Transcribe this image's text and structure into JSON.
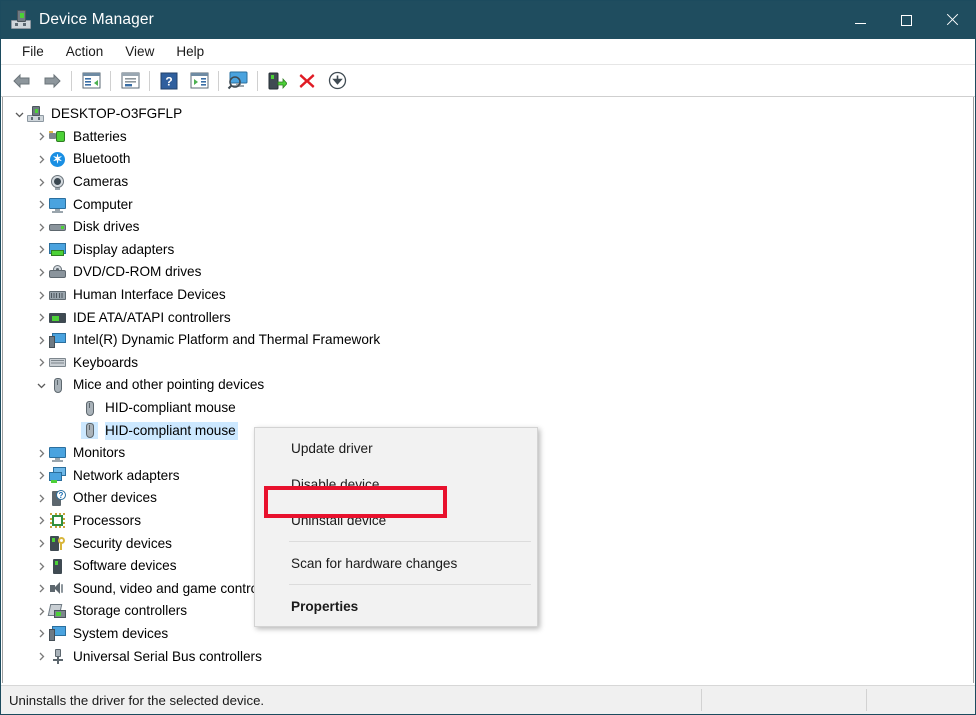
{
  "window": {
    "title": "Device Manager",
    "app_icon": "device-manager-icon",
    "titlebar_color": "#1f4d5f",
    "controls": {
      "minimize": "minimize-icon",
      "maximize": "maximize-icon",
      "close": "close-icon"
    }
  },
  "menubar": {
    "items": [
      {
        "label": "File"
      },
      {
        "label": "Action"
      },
      {
        "label": "View"
      },
      {
        "label": "Help"
      }
    ]
  },
  "toolbar": {
    "buttons": [
      {
        "name": "back-icon"
      },
      {
        "name": "forward-icon"
      },
      {
        "name": "separator"
      },
      {
        "name": "show-hide-console-tree-icon"
      },
      {
        "name": "separator"
      },
      {
        "name": "properties-icon"
      },
      {
        "name": "separator"
      },
      {
        "name": "help-icon"
      },
      {
        "name": "show-hide-action-pane-icon"
      },
      {
        "name": "separator"
      },
      {
        "name": "scan-for-hardware-changes-icon"
      },
      {
        "name": "separator"
      },
      {
        "name": "update-driver-icon"
      },
      {
        "name": "uninstall-device-icon"
      },
      {
        "name": "disable-device-icon"
      }
    ]
  },
  "tree": {
    "root": {
      "label": "DESKTOP-O3FGFLP",
      "icon": "computer-icon",
      "expanded": true
    },
    "items": [
      {
        "label": "Batteries",
        "icon": "battery-icon",
        "expanded": false,
        "level": 1
      },
      {
        "label": "Bluetooth",
        "icon": "bluetooth-icon",
        "expanded": false,
        "level": 1
      },
      {
        "label": "Cameras",
        "icon": "camera-icon",
        "expanded": false,
        "level": 1
      },
      {
        "label": "Computer",
        "icon": "monitor-icon",
        "expanded": false,
        "level": 1
      },
      {
        "label": "Disk drives",
        "icon": "disk-drive-icon",
        "expanded": false,
        "level": 1
      },
      {
        "label": "Display adapters",
        "icon": "display-adapter-icon",
        "expanded": false,
        "level": 1
      },
      {
        "label": "DVD/CD-ROM drives",
        "icon": "dvd-drive-icon",
        "expanded": false,
        "level": 1
      },
      {
        "label": "Human Interface Devices",
        "icon": "hid-icon",
        "expanded": false,
        "level": 1
      },
      {
        "label": "IDE ATA/ATAPI controllers",
        "icon": "ide-controller-icon",
        "expanded": false,
        "level": 1
      },
      {
        "label": "Intel(R) Dynamic Platform and Thermal Framework",
        "icon": "system-device-icon",
        "expanded": false,
        "level": 1
      },
      {
        "label": "Keyboards",
        "icon": "keyboard-icon",
        "expanded": false,
        "level": 1
      },
      {
        "label": "Mice and other pointing devices",
        "icon": "mouse-icon",
        "expanded": true,
        "level": 1
      },
      {
        "label": "HID-compliant mouse",
        "icon": "mouse-icon",
        "expanded": null,
        "level": 2,
        "selected": false
      },
      {
        "label": "HID-compliant mouse",
        "icon": "mouse-icon",
        "expanded": null,
        "level": 2,
        "selected": true
      },
      {
        "label": "Monitors",
        "icon": "monitor-icon",
        "expanded": false,
        "level": 1
      },
      {
        "label": "Network adapters",
        "icon": "network-adapter-icon",
        "expanded": false,
        "level": 1
      },
      {
        "label": "Other devices",
        "icon": "unknown-device-icon",
        "expanded": false,
        "level": 1
      },
      {
        "label": "Processors",
        "icon": "processor-icon",
        "expanded": false,
        "level": 1
      },
      {
        "label": "Security devices",
        "icon": "security-device-icon",
        "expanded": false,
        "level": 1
      },
      {
        "label": "Software devices",
        "icon": "software-device-icon",
        "expanded": false,
        "level": 1
      },
      {
        "label": "Sound, video and game controllers",
        "icon": "sound-icon",
        "expanded": false,
        "level": 1
      },
      {
        "label": "Storage controllers",
        "icon": "storage-controller-icon",
        "expanded": false,
        "level": 1
      },
      {
        "label": "System devices",
        "icon": "system-device-icon",
        "expanded": false,
        "level": 1
      },
      {
        "label": "Universal Serial Bus controllers",
        "icon": "usb-controller-icon",
        "expanded": false,
        "level": 1
      }
    ]
  },
  "context_menu": {
    "items": [
      {
        "label": "Update driver",
        "bold": false,
        "highlighted": false
      },
      {
        "label": "Disable device",
        "bold": false,
        "highlighted": false
      },
      {
        "label": "Uninstall device",
        "bold": false,
        "highlighted": true
      },
      {
        "separator": true
      },
      {
        "label": "Scan for hardware changes",
        "bold": false,
        "highlighted": false
      },
      {
        "separator": true
      },
      {
        "label": "Properties",
        "bold": true,
        "highlighted": false
      }
    ],
    "highlight_color": "#e8112d"
  },
  "statusbar": {
    "message": "Uninstalls the driver for the selected device.",
    "pane2": "",
    "pane3": ""
  }
}
